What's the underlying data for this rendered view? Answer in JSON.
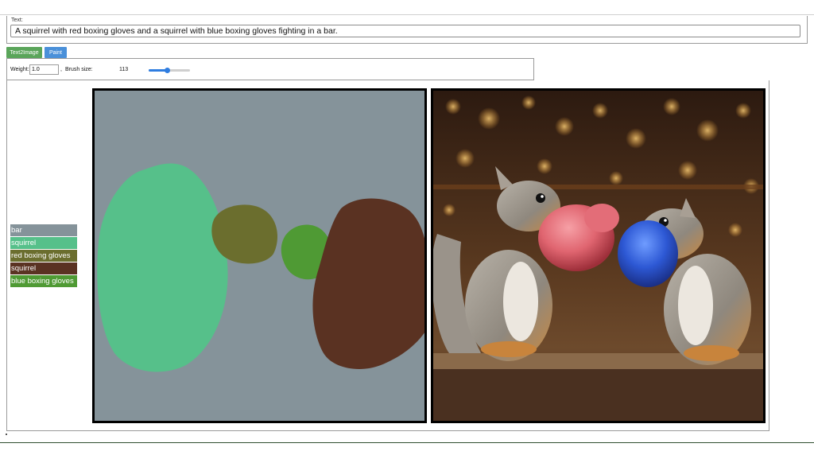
{
  "prompt": {
    "label": "Text:",
    "value": "A squirrel with red boxing gloves and a squirrel with blue boxing gloves fighting in a bar."
  },
  "tabs": [
    {
      "label": "Text2Image",
      "color": "#5aa55a"
    },
    {
      "label": "Paint",
      "color": "#4a90d9"
    }
  ],
  "controls": {
    "weight_label": "Weight:",
    "weight_value": "1.0",
    "separator": ",",
    "brush_label": "Brush size:",
    "brush_value": "113",
    "brush_slider_fraction": 0.45,
    "slider_color": "#2f7de0"
  },
  "legend": [
    {
      "label": "bar",
      "color": "#85939a"
    },
    {
      "label": "squirrel",
      "color": "#56c08a"
    },
    {
      "label": "red boxing gloves",
      "color": "#6b6e2e"
    },
    {
      "label": "squirrel",
      "color": "#5a3222"
    },
    {
      "label": "blue boxing gloves",
      "color": "#4f9a34"
    }
  ],
  "canvas": {
    "background_color": "#85939a",
    "region_colors": [
      "#56c08a",
      "#6b6e2e",
      "#4f9a34",
      "#5a3222"
    ]
  },
  "generated_image": {
    "subject": "two squirrels with red and blue boxing gloves in a bar"
  }
}
